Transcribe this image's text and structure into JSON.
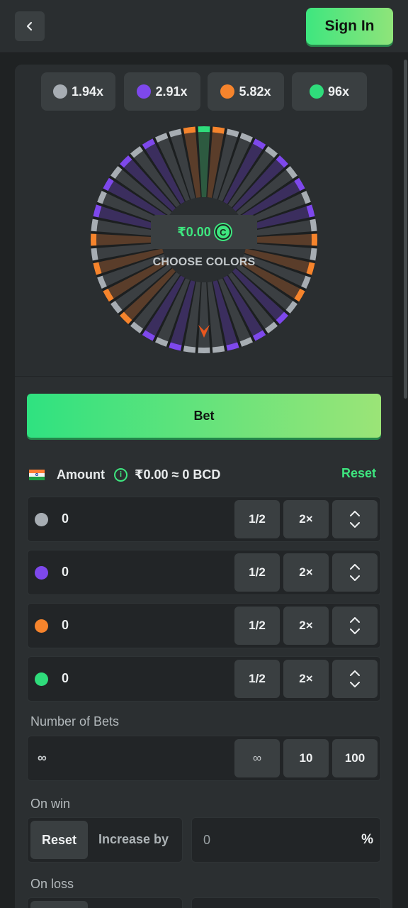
{
  "header": {
    "back_icon": "chevron-left-icon",
    "signin_label": "Sign In"
  },
  "multipliers": [
    {
      "label": "1.94x",
      "color": "#a7adb3"
    },
    {
      "label": "2.91x",
      "color": "#7e48ec"
    },
    {
      "label": "5.82x",
      "color": "#f6842c"
    },
    {
      "label": "96x",
      "color": "#2fdc7b"
    }
  ],
  "wheel": {
    "center_amount": "₹0.00",
    "coin_icon_letter": "C",
    "choose_label": "CHOOSE COLORS",
    "segments": [
      "green",
      "orange",
      "gray",
      "gray",
      "purple",
      "gray",
      "purple",
      "gray",
      "purple",
      "gray",
      "purple",
      "gray",
      "orange",
      "gray",
      "orange",
      "gray",
      "orange",
      "gray",
      "purple",
      "gray",
      "purple",
      "gray",
      "purple",
      "gray",
      "gray",
      "gray",
      "purple",
      "gray",
      "purple",
      "gray",
      "orange",
      "gray",
      "orange",
      "gray",
      "orange",
      "gray",
      "orange",
      "gray",
      "purple",
      "gray",
      "purple",
      "gray",
      "purple",
      "gray",
      "purple",
      "gray",
      "gray",
      "orange"
    ]
  },
  "bet_button_label": "Bet",
  "amount": {
    "label": "Amount",
    "conversion": "₹0.00 ≈ 0 BCD",
    "reset_label": "Reset",
    "info_icon": "i"
  },
  "bet_rows": [
    {
      "color": "#a7adb3",
      "value": "0",
      "half": "1/2",
      "double": "2×"
    },
    {
      "color": "#7e48ec",
      "value": "0",
      "half": "1/2",
      "double": "2×"
    },
    {
      "color": "#f6842c",
      "value": "0",
      "half": "1/2",
      "double": "2×"
    },
    {
      "color": "#2fdc7b",
      "value": "0",
      "half": "1/2",
      "double": "2×"
    }
  ],
  "number_of_bets": {
    "label": "Number of Bets",
    "value": "∞",
    "options": [
      "∞",
      "10",
      "100"
    ]
  },
  "on_win": {
    "label": "On win",
    "reset": "Reset",
    "increase": "Increase by",
    "value": "0",
    "unit": "%"
  },
  "on_loss": {
    "label": "On loss"
  },
  "colors": {
    "accent_green": "#3ee67f",
    "gray": "#a7adb3",
    "purple": "#7e48ec",
    "orange": "#f6842c"
  }
}
